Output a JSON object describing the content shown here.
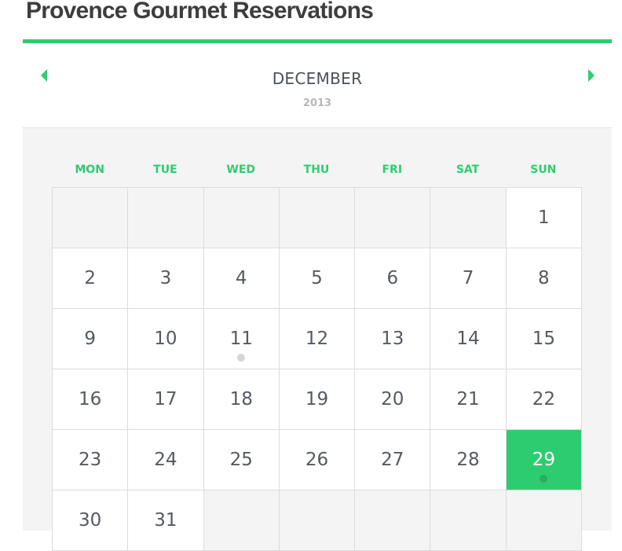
{
  "page": {
    "title": "Provence Gourmet Reservations"
  },
  "colors": {
    "accent": "#2ecc71",
    "text": "#555a61",
    "muted": "#b8b8b8",
    "empty_cell": "#f4f4f4"
  },
  "calendar": {
    "month": "DECEMBER",
    "year": "2013",
    "prev_icon": "caret-left-icon",
    "next_icon": "caret-right-icon",
    "weekdays": [
      "MON",
      "TUE",
      "WED",
      "THU",
      "FRI",
      "SAT",
      "SUN"
    ],
    "weeks": [
      [
        null,
        null,
        null,
        null,
        null,
        null,
        1
      ],
      [
        2,
        3,
        4,
        5,
        6,
        7,
        8
      ],
      [
        9,
        10,
        11,
        12,
        13,
        14,
        15
      ],
      [
        16,
        17,
        18,
        19,
        20,
        21,
        22
      ],
      [
        23,
        24,
        25,
        26,
        27,
        28,
        29
      ],
      [
        30,
        31,
        null,
        null,
        null,
        null,
        null
      ]
    ],
    "selected_day": 29,
    "event_days": [
      11,
      29
    ]
  }
}
